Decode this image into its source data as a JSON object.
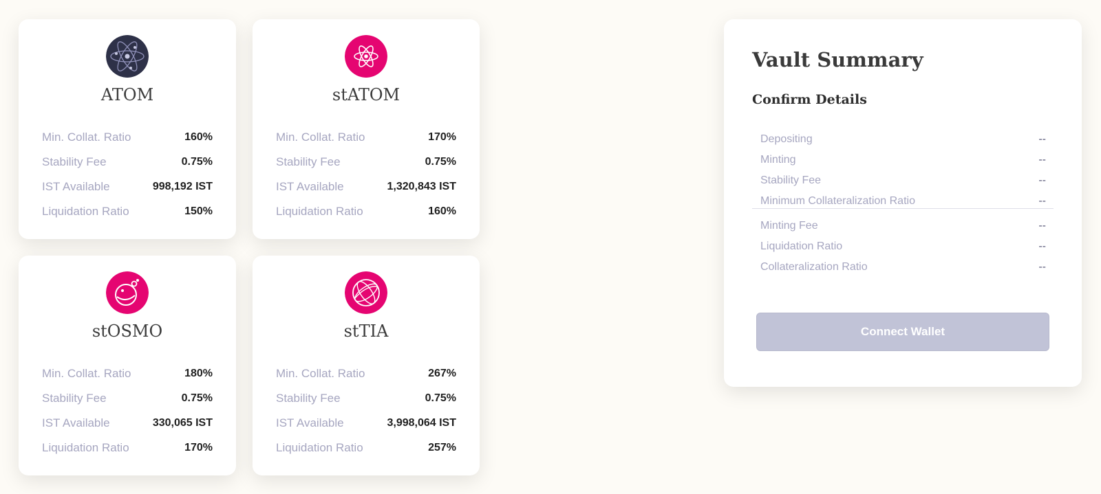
{
  "vaults": [
    {
      "name": "ATOM",
      "icon": "cosmos-atom-icon",
      "icon_color": "#2e3148",
      "rows": [
        {
          "label": "Min. Collat. Ratio",
          "value": "160%"
        },
        {
          "label": "Stability Fee",
          "value": "0.75%"
        },
        {
          "label": "IST Available",
          "value": "998,192 IST"
        },
        {
          "label": "Liquidation Ratio",
          "value": "150%"
        }
      ]
    },
    {
      "name": "stATOM",
      "icon": "stride-atom-icon",
      "icon_color": "#e50571",
      "rows": [
        {
          "label": "Min. Collat. Ratio",
          "value": "170%"
        },
        {
          "label": "Stability Fee",
          "value": "0.75%"
        },
        {
          "label": "IST Available",
          "value": "1,320,843 IST"
        },
        {
          "label": "Liquidation Ratio",
          "value": "160%"
        }
      ]
    },
    {
      "name": "stOSMO",
      "icon": "stride-osmo-icon",
      "icon_color": "#e50571",
      "rows": [
        {
          "label": "Min. Collat. Ratio",
          "value": "180%"
        },
        {
          "label": "Stability Fee",
          "value": "0.75%"
        },
        {
          "label": "IST Available",
          "value": "330,065 IST"
        },
        {
          "label": "Liquidation Ratio",
          "value": "170%"
        }
      ]
    },
    {
      "name": "stTIA",
      "icon": "stride-tia-icon",
      "icon_color": "#e50571",
      "rows": [
        {
          "label": "Min. Collat. Ratio",
          "value": "267%"
        },
        {
          "label": "Stability Fee",
          "value": "0.75%"
        },
        {
          "label": "IST Available",
          "value": "3,998,064 IST"
        },
        {
          "label": "Liquidation Ratio",
          "value": "257%"
        }
      ]
    }
  ],
  "summary": {
    "title": "Vault Summary",
    "subtitle": "Confirm Details",
    "group1": [
      {
        "label": "Depositing",
        "value": "--"
      },
      {
        "label": "Minting",
        "value": "--"
      },
      {
        "label": "Stability Fee",
        "value": "--"
      },
      {
        "label": "Minimum Collateralization Ratio",
        "value": "--"
      }
    ],
    "group2": [
      {
        "label": "Minting Fee",
        "value": "--"
      },
      {
        "label": "Liquidation Ratio",
        "value": "--"
      },
      {
        "label": "Collateralization Ratio",
        "value": "--"
      }
    ],
    "button_label": "Connect Wallet"
  }
}
